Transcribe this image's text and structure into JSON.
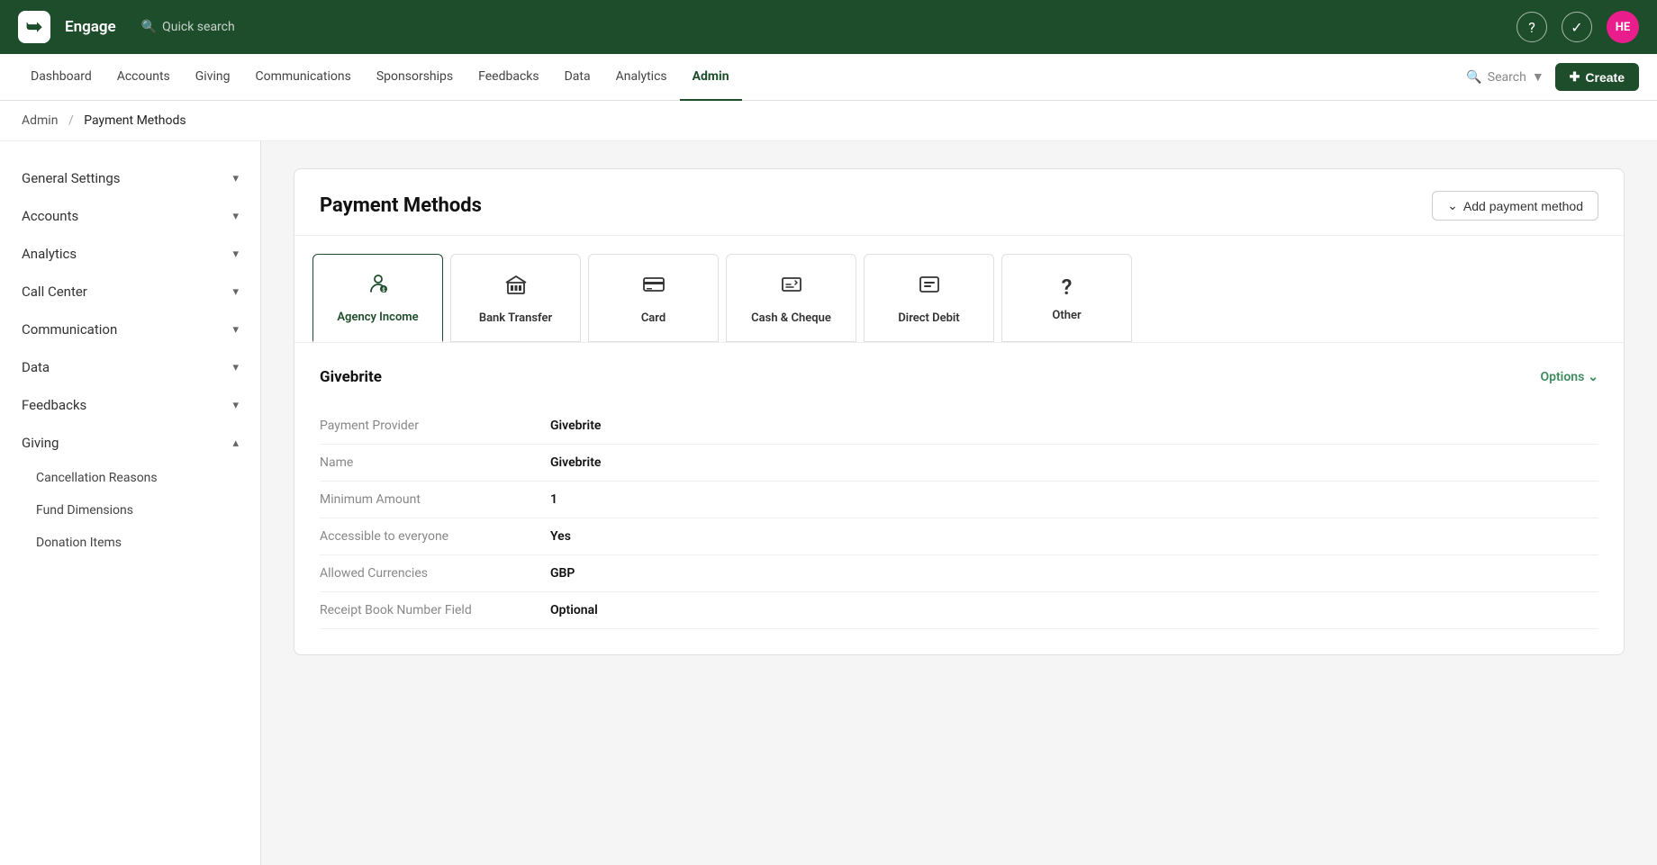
{
  "topbar": {
    "app_name": "Engage",
    "quick_search": "Quick search",
    "avatar_initials": "HE",
    "avatar_color": "#e91e8c"
  },
  "nav": {
    "items": [
      {
        "label": "Dashboard",
        "active": false
      },
      {
        "label": "Accounts",
        "active": false
      },
      {
        "label": "Giving",
        "active": false
      },
      {
        "label": "Communications",
        "active": false
      },
      {
        "label": "Sponsorships",
        "active": false
      },
      {
        "label": "Feedbacks",
        "active": false
      },
      {
        "label": "Data",
        "active": false
      },
      {
        "label": "Analytics",
        "active": false
      },
      {
        "label": "Admin",
        "active": true
      }
    ],
    "search_placeholder": "Search",
    "create_label": "Create"
  },
  "breadcrumb": {
    "root": "Admin",
    "current": "Payment Methods"
  },
  "sidebar": {
    "items": [
      {
        "label": "General Settings",
        "chevron": "▾",
        "expanded": false
      },
      {
        "label": "Accounts",
        "chevron": "▾",
        "expanded": false
      },
      {
        "label": "Analytics",
        "chevron": "▾",
        "expanded": false
      },
      {
        "label": "Call Center",
        "chevron": "▾",
        "expanded": false
      },
      {
        "label": "Communication",
        "chevron": "▾",
        "expanded": false
      },
      {
        "label": "Data",
        "chevron": "▾",
        "expanded": false
      },
      {
        "label": "Feedbacks",
        "chevron": "▾",
        "expanded": false
      },
      {
        "label": "Giving",
        "chevron": "▴",
        "expanded": true
      }
    ],
    "giving_subitems": [
      {
        "label": "Cancellation Reasons"
      },
      {
        "label": "Fund Dimensions"
      },
      {
        "label": "Donation Items"
      }
    ]
  },
  "main": {
    "title": "Payment Methods",
    "add_button": "Add payment method",
    "payment_tabs": [
      {
        "label": "Agency Income",
        "icon": "👤",
        "active": true
      },
      {
        "label": "Bank Transfer",
        "icon": "🏛",
        "active": false
      },
      {
        "label": "Card",
        "icon": "💳",
        "active": false
      },
      {
        "label": "Cash & Cheque",
        "icon": "✏️",
        "active": false
      },
      {
        "label": "Direct Debit",
        "icon": "🖥",
        "active": false
      },
      {
        "label": "Other",
        "icon": "❓",
        "active": false
      }
    ],
    "detail_title": "Givebrite",
    "options_label": "Options",
    "detail_rows": [
      {
        "label": "Payment Provider",
        "value": "Givebrite"
      },
      {
        "label": "Name",
        "value": "Givebrite"
      },
      {
        "label": "Minimum Amount",
        "value": "1"
      },
      {
        "label": "Accessible to everyone",
        "value": "Yes"
      },
      {
        "label": "Allowed Currencies",
        "value": "GBP"
      },
      {
        "label": "Receipt Book Number Field",
        "value": "Optional"
      }
    ]
  }
}
